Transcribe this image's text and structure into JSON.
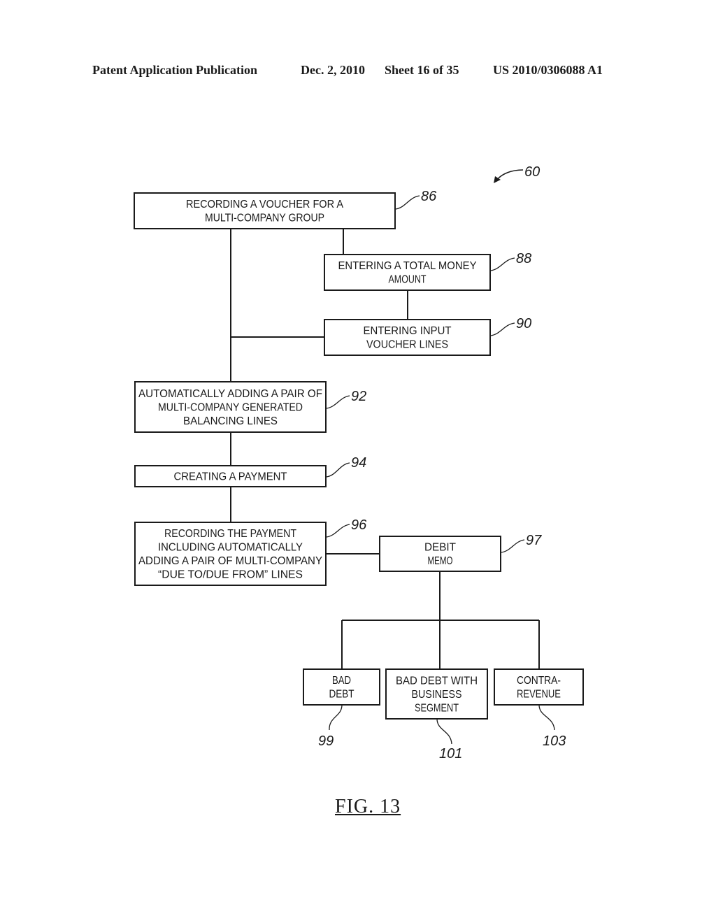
{
  "header": {
    "publication": "Patent Application Publication",
    "date": "Dec. 2, 2010",
    "sheet": "Sheet 16 of 35",
    "number": "US 2010/0306088 A1"
  },
  "figure": {
    "label": "FIG. 13",
    "ref": "60",
    "nodes": [
      {
        "id": "86",
        "lines": [
          "RECORDING A VOUCHER FOR A",
          "MULTI-COMPANY GROUP"
        ]
      },
      {
        "id": "88",
        "lines": [
          "ENTERING A TOTAL MONEY",
          "AMOUNT"
        ]
      },
      {
        "id": "90",
        "lines": [
          "ENTERING INPUT",
          "VOUCHER LINES"
        ]
      },
      {
        "id": "92",
        "lines": [
          "AUTOMATICALLY ADDING A PAIR OF",
          "MULTI-COMPANY GENERATED",
          "BALANCING LINES"
        ]
      },
      {
        "id": "94",
        "lines": [
          "CREATING A PAYMENT"
        ]
      },
      {
        "id": "96",
        "lines": [
          "RECORDING THE PAYMENT",
          "INCLUDING AUTOMATICALLY",
          "ADDING A PAIR OF MULTI-COMPANY",
          "“DUE TO/DUE FROM” LINES"
        ]
      },
      {
        "id": "97",
        "lines": [
          "DEBIT",
          "MEMO"
        ]
      },
      {
        "id": "99",
        "lines": [
          "BAD",
          "DEBT"
        ]
      },
      {
        "id": "101",
        "lines": [
          "BAD DEBT WITH",
          "BUSINESS",
          "SEGMENT"
        ]
      },
      {
        "id": "103",
        "lines": [
          "CONTRA-",
          "REVENUE"
        ]
      }
    ],
    "edges": [
      [
        "86",
        "88"
      ],
      [
        "88",
        "90"
      ],
      [
        "86",
        "92"
      ],
      [
        "90",
        "92"
      ],
      [
        "92",
        "94"
      ],
      [
        "94",
        "96"
      ],
      [
        "96",
        "97"
      ],
      [
        "97",
        "99"
      ],
      [
        "97",
        "101"
      ],
      [
        "97",
        "103"
      ]
    ]
  }
}
